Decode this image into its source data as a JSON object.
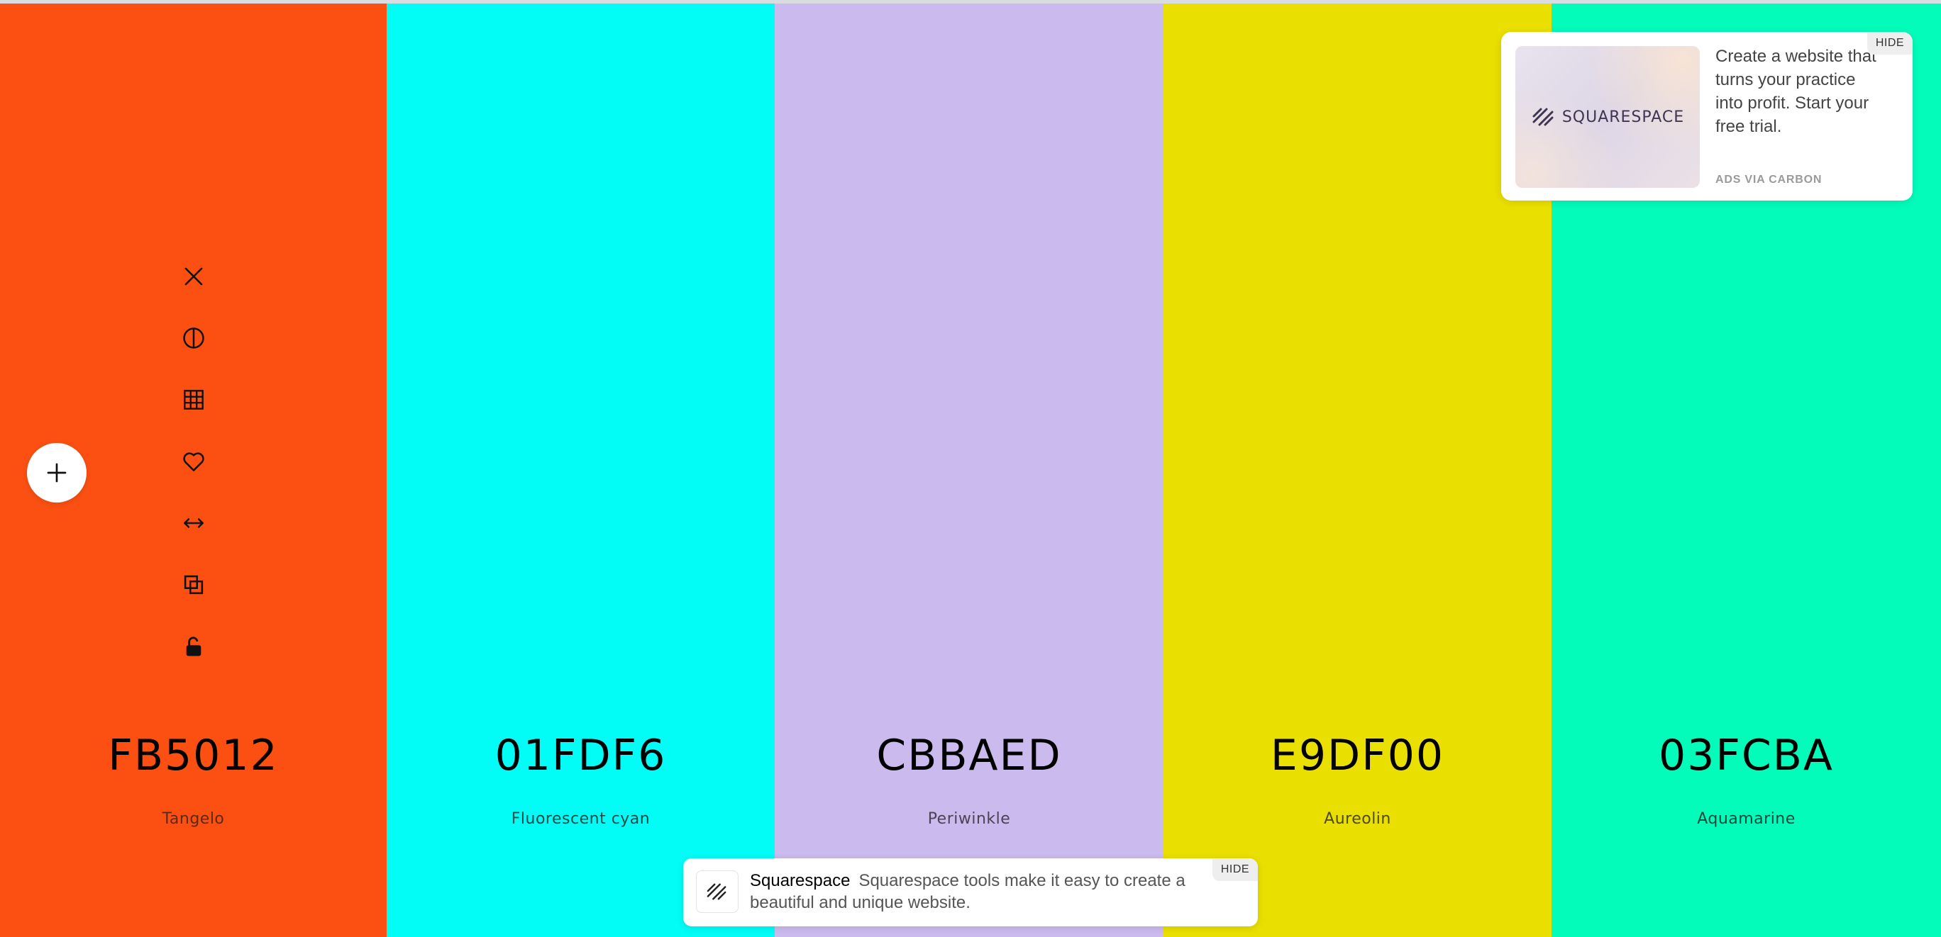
{
  "palette": {
    "colors": [
      {
        "hex": "FB5012",
        "name": "Tangelo",
        "color": "#FB5012"
      },
      {
        "hex": "01FDF6",
        "name": "Fluorescent cyan",
        "color": "#01FDF6"
      },
      {
        "hex": "CBBAED",
        "name": "Periwinkle",
        "color": "#CBBAED"
      },
      {
        "hex": "E9DF00",
        "name": "Aureolin",
        "color": "#E9DF00"
      },
      {
        "hex": "03FCBA",
        "name": "Aquamarine",
        "color": "#03FCBA"
      }
    ]
  },
  "toolbar": {
    "items": [
      {
        "icon": "close-icon"
      },
      {
        "icon": "shades-icon"
      },
      {
        "icon": "grid-icon"
      },
      {
        "icon": "heart-icon"
      },
      {
        "icon": "drag-icon"
      },
      {
        "icon": "copy-icon"
      },
      {
        "icon": "unlock-icon"
      }
    ],
    "add_icon": "plus-icon"
  },
  "ad": {
    "hide_label": "HIDE",
    "brand_logo_text": "SQUARESPACE",
    "text": "Create a website that turns your practice into profit. Start your free trial.",
    "via": "ADS VIA CARBON"
  },
  "banner": {
    "hide_label": "HIDE",
    "brand": "Squarespace",
    "text": "Squarespace tools make it easy to create a beautiful and unique website."
  }
}
